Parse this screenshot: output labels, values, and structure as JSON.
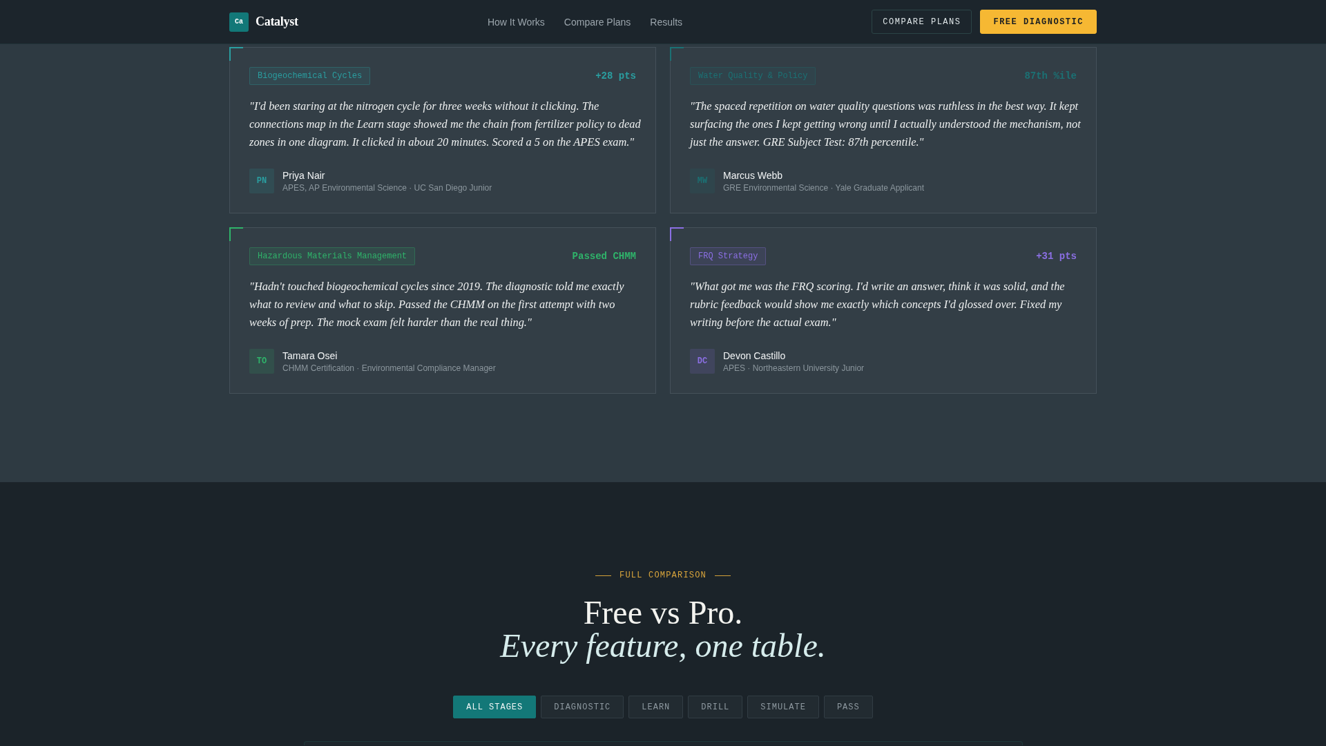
{
  "header": {
    "logo_mark": "Ca",
    "brand": "Catalyst",
    "nav": [
      "How It Works",
      "Compare Plans",
      "Results"
    ],
    "buttons": [
      {
        "label": "COMPARE PLANS",
        "kind": "outline"
      },
      {
        "label": "FREE DIAGNOSTIC",
        "kind": "primary"
      }
    ]
  },
  "testimonials": [
    {
      "tag": "Biogeochemical Cycles",
      "result": "+28 pts",
      "quote": "\"I'd been staring at the nitrogen cycle for three weeks without it clicking. The connections map in the Learn stage showed me the chain from fertilizer policy to dead zones in one diagram. It clicked in about 20 minutes. Scored a 5 on the APES exam.\"",
      "initials": "PN",
      "name": "Priya Nair",
      "detail": "APES, AP Environmental Science · UC San Diego Junior",
      "color": "#2a9ea0"
    },
    {
      "tag": "Water Quality & Policy",
      "result": "87th %ile",
      "quote": "\"The spaced repetition on water quality questions was ruthless in the best way. It kept surfacing the ones I kept getting wrong until I actually understood the mechanism, not just the answer. GRE Subject Test: 87th percentile.\"",
      "initials": "MW",
      "name": "Marcus Webb",
      "detail": "GRE Environmental Science · Yale Graduate Applicant",
      "color": "#1b7174"
    },
    {
      "tag": "Hazardous Materials Management",
      "result": "Passed CHMM",
      "quote": "\"Hadn't touched biogeochemical cycles since 2019. The diagnostic told me exactly what to review and what to skip. Passed the CHMM on the first attempt with two weeks of prep. The mock exam felt harder than the real thing.\"",
      "initials": "TO",
      "name": "Tamara Osei",
      "detail": "CHMM Certification · Environmental Compliance Manager",
      "color": "#2fb36a"
    },
    {
      "tag": "FRQ Strategy",
      "result": "+31 pts",
      "quote": "\"What got me was the FRQ scoring. I'd write an answer, think it was solid, and the rubric feedback would show me exactly which concepts I'd glossed over. Fixed my writing before the actual exam.\"",
      "initials": "DC",
      "name": "Devon Castillo",
      "detail": "APES · Northeastern University Junior",
      "color": "#8b6fe3"
    }
  ],
  "comparison": {
    "eyebrow": "FULL COMPARISON",
    "heading": "Free vs Pro. *Every feature, one table.*",
    "tabs": [
      {
        "label": "ALL STAGES",
        "selected": true
      },
      {
        "label": "DIAGNOSTIC",
        "selected": false
      },
      {
        "label": "LEARN",
        "selected": false
      },
      {
        "label": "DRILL",
        "selected": false
      },
      {
        "label": "SIMULATE",
        "selected": false
      },
      {
        "label": "PASS",
        "selected": false
      }
    ]
  }
}
